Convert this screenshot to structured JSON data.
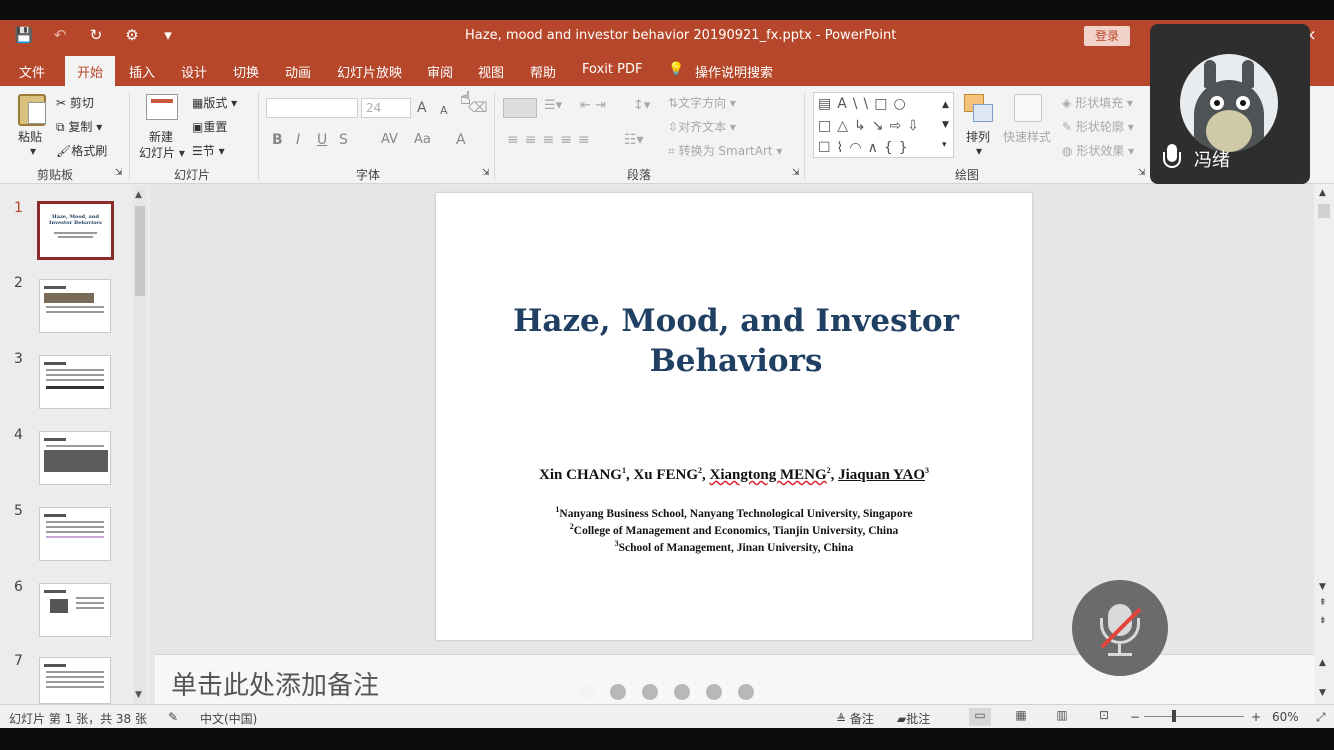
{
  "window": {
    "title": "Haze, mood and investor behavior 20190921_fx.pptx  -  PowerPoint",
    "login_label": "登录",
    "close_glyph": "×"
  },
  "qat": {
    "save_icon": "💾",
    "undo_icon": "↶",
    "redo_icon": "↻",
    "customize_icon": "⚙",
    "more_icon": "▾"
  },
  "tabs": [
    "文件",
    "开始",
    "插入",
    "设计",
    "切换",
    "动画",
    "幻灯片放映",
    "审阅",
    "视图",
    "帮助",
    "Foxit PDF",
    "操作说明搜索"
  ],
  "ribbon": {
    "clipboard": {
      "paste": "粘贴",
      "cut": "剪切",
      "copy": "复制",
      "format_painter": "格式刷",
      "label": "剪贴板"
    },
    "slides": {
      "new_slide_line1": "新建",
      "new_slide_line2": "幻灯片",
      "layout": "版式",
      "reset": "重置",
      "section": "节",
      "label": "幻灯片"
    },
    "font": {
      "size": "24",
      "label": "字体",
      "buttons": [
        "B",
        "I",
        "U",
        "S",
        "AV",
        "Aa",
        "A"
      ],
      "grow": "A",
      "shrink": "A"
    },
    "paragraph": {
      "text_direction": "文字方向",
      "align_text": "对齐文本",
      "smartart": "转换为 SmartArt",
      "label": "段落"
    },
    "drawing": {
      "arrange": "排列",
      "quick_styles": "快速样式",
      "shape_fill": "形状填充",
      "shape_outline": "形状轮廓",
      "shape_effects": "形状效果",
      "label": "绘图",
      "shapes_row1": "▤A\\\\□○",
      "shapes_row2": "□△↳↘⇨⇩",
      "shapes_row3": "☐⌇◠∧{}"
    }
  },
  "thumbnails": {
    "numbers": [
      "1",
      "2",
      "3",
      "4",
      "5",
      "6",
      "7"
    ],
    "slide1_title": "Haze, Mood, and Investor Behaviors"
  },
  "slide": {
    "title_line1": "Haze, Mood, and Investor",
    "title_line2": "Behaviors",
    "authors": [
      {
        "name": "Xin CHANG",
        "sup": "1"
      },
      {
        "name": "Xu FENG",
        "sup": "2"
      },
      {
        "name": "Xiangtong MENG",
        "sup": "2"
      },
      {
        "name": "Jiaquan YAO",
        "sup": "3"
      }
    ],
    "affiliations": [
      {
        "sup": "1",
        "text": "Nanyang Business School, Nanyang Technological University, Singapore"
      },
      {
        "sup": "2",
        "text": "College of Management and Economics, Tianjin University, China"
      },
      {
        "sup": "3",
        "text": "School of Management, Jinan University, China"
      }
    ]
  },
  "notes": {
    "placeholder": "单击此处添加备注"
  },
  "status": {
    "slide_info": "幻灯片 第 1 张，共 38 张",
    "language": "中文(中国)",
    "notes": "备注",
    "comments": "批注",
    "zoom": "60%",
    "zoom_minus": "−",
    "zoom_plus": "+"
  },
  "meeting": {
    "participant_name": "冯绪",
    "page_dots": 6,
    "active_dot": 0
  }
}
